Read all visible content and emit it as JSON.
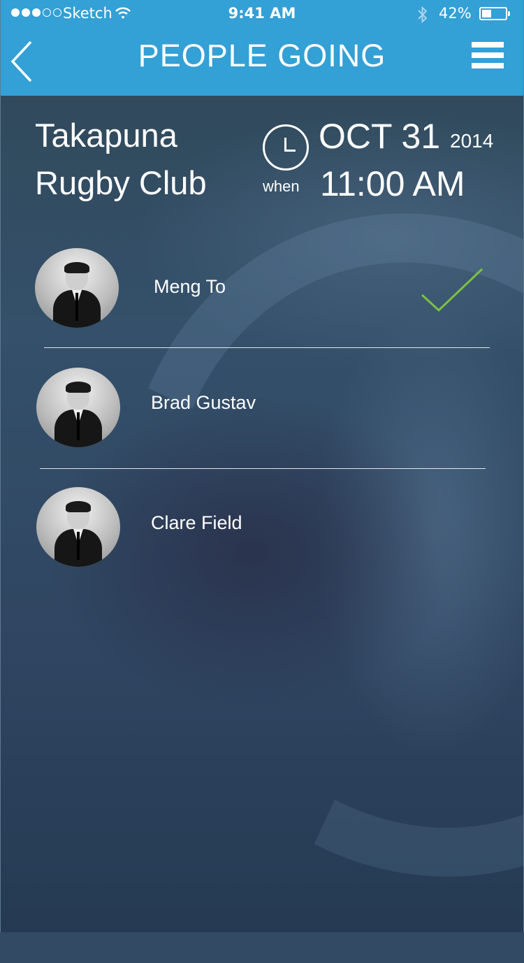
{
  "status_bar": {
    "carrier": "Sketch",
    "time": "9:41 AM",
    "battery": "42%",
    "battery_level": 0.42
  },
  "nav": {
    "title": "PEOPLE GOING",
    "back_icon": "chevron-left-icon",
    "menu_icon": "hamburger-menu-icon"
  },
  "event": {
    "venue_line1": "Takapuna",
    "venue_line2": "Rugby Club",
    "when_label": "when",
    "date": "OCT 31",
    "year": "2014",
    "time": "11:00 AM"
  },
  "people": [
    {
      "name": "Meng To",
      "going": true
    },
    {
      "name": "Brad Gustav",
      "going": false
    },
    {
      "name": "Clare Field",
      "going": false
    }
  ],
  "colors": {
    "nav_bar": "#33a0d6",
    "check": "#7cc142"
  }
}
